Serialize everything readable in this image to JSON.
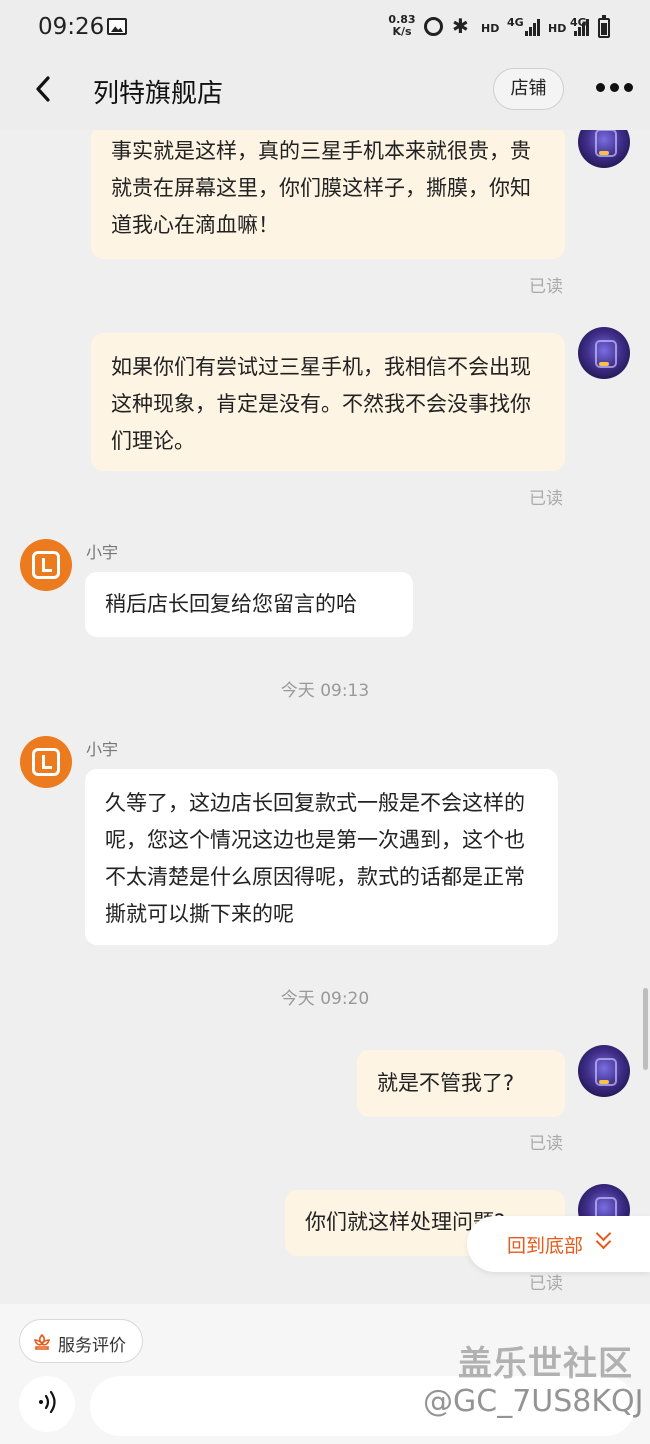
{
  "status_bar": {
    "time": "09:26",
    "net_speed": "0.83\nK/s",
    "hd1": "HD",
    "g1": "4G",
    "hd2": "HD",
    "g2": "4G"
  },
  "nav": {
    "title": "列特旗舰店",
    "shop_label": "店铺",
    "back_icon": "back-arrow-icon",
    "more_icon": "more-dots-icon"
  },
  "messages": [
    {
      "from": "user",
      "text": "事实就是这样，真的三星手机本来就很贵，贵就贵在屏幕这里，你们膜这样子，撕膜，你知道我心在滴血嘛！",
      "status": "已读"
    },
    {
      "from": "user",
      "text": "如果你们有尝试过三星手机，我相信不会出现这种现象，肯定是没有。不然我不会没事找你们理论。",
      "status": "已读"
    },
    {
      "from": "shop",
      "sender": "小宇",
      "text": "稍后店长回复给您留言的哈"
    },
    {
      "type": "time",
      "text": "今天  09:13"
    },
    {
      "from": "shop",
      "sender": "小宇",
      "text": "久等了，这边店长回复款式一般是不会这样的呢，您这个情况这边也是第一次遇到，这个也不太清楚是什么原因得呢，款式的话都是正常撕就可以撕下来的呢"
    },
    {
      "type": "time",
      "text": "今天  09:20"
    },
    {
      "from": "user",
      "text": "就是不管我了?",
      "status": "已读"
    },
    {
      "from": "user",
      "text": "你们就这样处理问题?",
      "status": "已读"
    }
  ],
  "back_to_bottom": "回到底部",
  "bottom_bar": {
    "rate_label": "服务评价",
    "voice_icon": "voice-wave-icon",
    "input_value": ""
  },
  "watermark": {
    "line1": "盖乐世社区",
    "line2": "@GC_7US8KQJ"
  },
  "colors": {
    "accent": "#e65a1c",
    "user_bubble": "#fdf4e4",
    "shop_avatar": "#ec7a1f"
  }
}
